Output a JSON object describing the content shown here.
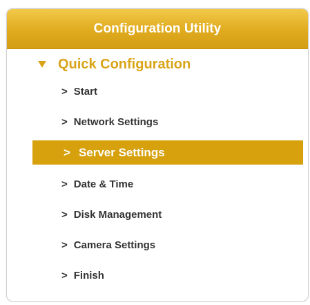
{
  "panel": {
    "title": "Configuration Utility"
  },
  "section": {
    "label": "Quick Configuration",
    "expanded_icon": "triangle-down-icon"
  },
  "nav": {
    "chevron": ">",
    "items": [
      {
        "label": "Start",
        "active": false
      },
      {
        "label": "Network Settings",
        "active": false
      },
      {
        "label": "Server Settings",
        "active": true
      },
      {
        "label": "Date & Time",
        "active": false
      },
      {
        "label": "Disk Management",
        "active": false
      },
      {
        "label": "Camera Settings",
        "active": false
      },
      {
        "label": "Finish",
        "active": false
      }
    ]
  },
  "colors": {
    "accent": "#d6a10d",
    "header_top": "#f2c94a",
    "header_bottom": "#d39d14",
    "text": "#333333"
  }
}
